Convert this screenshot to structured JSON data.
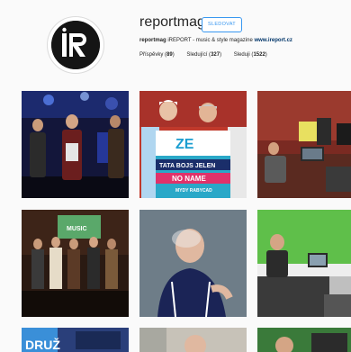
{
  "profile": {
    "username": "reportmag",
    "follow_label": "SLEDOVAT",
    "bio_name": "reportmag",
    "bio_text": " iREPORT - music & style magazine ",
    "bio_link": "www.ireport.cz",
    "stats": [
      {
        "label": "Příspěvky",
        "value": "89"
      },
      {
        "label": "Sledující",
        "value": "327"
      },
      {
        "label": "Sleduji",
        "value": "1522"
      }
    ]
  },
  "posts": {
    "post2": {
      "sign_logo": "ZE",
      "sign_line": "TATA BOJS  JELEN",
      "sign_line2": "NO NAME",
      "sign_small": "MYDY RABYCAD"
    },
    "post4": {
      "screen_text": "MUSIC"
    },
    "post7": {
      "text": "DRUŽ"
    }
  },
  "colors": {
    "accent": "#3897f0",
    "link": "#003569"
  }
}
